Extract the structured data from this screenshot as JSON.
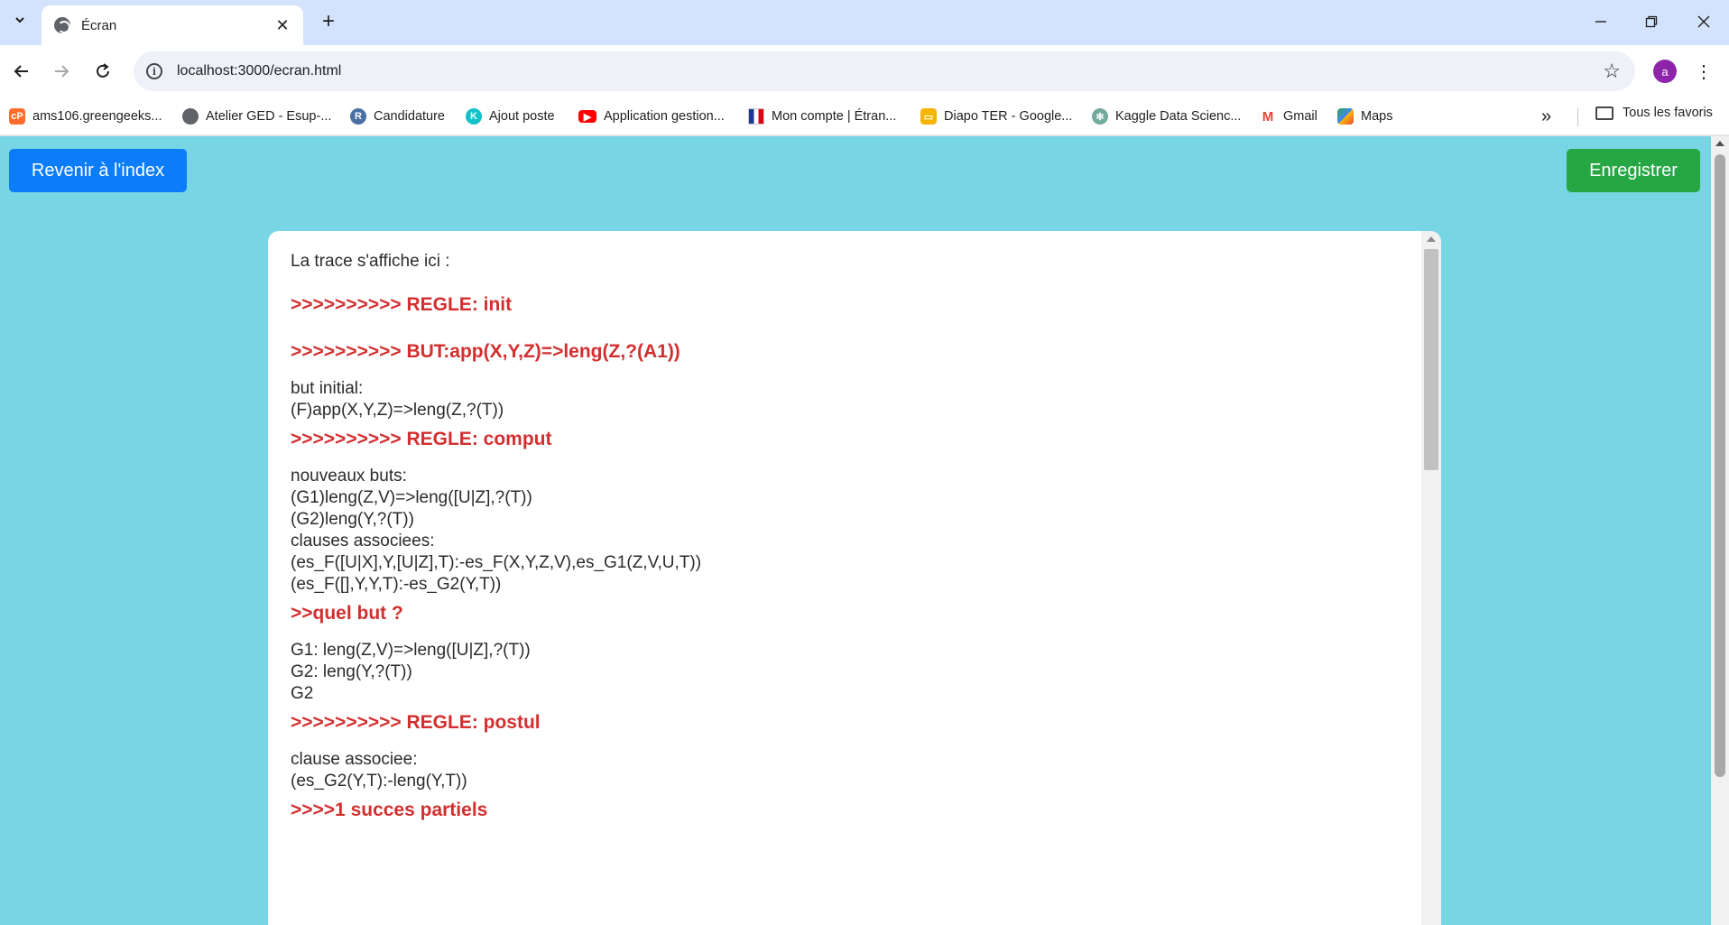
{
  "browser": {
    "tab_title": "Écran",
    "url": "localhost:3000/ecran.html",
    "avatar_letter": "a"
  },
  "bookmarks": {
    "items": [
      {
        "label": "ams106.greengeeks...",
        "icon": "cpanel-icon",
        "color": "#ff6c2c"
      },
      {
        "label": "Atelier GED - Esup-...",
        "icon": "globe-icon",
        "color": "#5f6368"
      },
      {
        "label": "Candidature",
        "icon": "r-icon",
        "color": "#4a6fa5"
      },
      {
        "label": "Ajout poste",
        "icon": "k-icon",
        "color": "#12c2c9"
      },
      {
        "label": "Application gestion...",
        "icon": "youtube-icon",
        "color": "#ff0000"
      },
      {
        "label": "Mon compte | Étran...",
        "icon": "france-flag-icon",
        "color": "#1a3a8f"
      },
      {
        "label": "Diapo TER - Google...",
        "icon": "slides-icon",
        "color": "#f4b400"
      },
      {
        "label": "Kaggle Data Scienc...",
        "icon": "openai-icon",
        "color": "#74aa9c"
      },
      {
        "label": "Gmail",
        "icon": "gmail-icon",
        "color": "#ea4335"
      },
      {
        "label": "Maps",
        "icon": "maps-icon",
        "color": "#34a853"
      }
    ],
    "more": "»",
    "folder_label": "Tous les favoris"
  },
  "page": {
    "back_button": "Revenir à l'index",
    "save_button": "Enregistrer",
    "colors": {
      "background": "#78d5e3",
      "back_button": "#0b7dfb",
      "save_button": "#26a744",
      "rule": "#d32f2f"
    },
    "trace": [
      {
        "kind": "text",
        "lines": [
          "La trace s'affiche ici :"
        ]
      },
      {
        "kind": "rule",
        "text": ">>>>>>>>>> REGLE: init"
      },
      {
        "kind": "rule",
        "text": ">>>>>>>>>> BUT:app(X,Y,Z)=>leng(Z,?(A1))"
      },
      {
        "kind": "text",
        "lines": [
          "but initial:",
          "(F)app(X,Y,Z)=>leng(Z,?(T))"
        ]
      },
      {
        "kind": "rule",
        "text": ">>>>>>>>>> REGLE: comput"
      },
      {
        "kind": "text",
        "lines": [
          "nouveaux buts:",
          "(G1)leng(Z,V)=>leng([U|Z],?(T))",
          "(G2)leng(Y,?(T))",
          "clauses associees:",
          "(es_F([U|X],Y,[U|Z],T):-es_F(X,Y,Z,V),es_G1(Z,V,U,T))",
          "(es_F([],Y,Y,T):-es_G2(Y,T))"
        ]
      },
      {
        "kind": "rule",
        "text": ">>quel but ?"
      },
      {
        "kind": "text",
        "lines": [
          "G1: leng(Z,V)=>leng([U|Z],?(T))",
          "G2: leng(Y,?(T))",
          "G2"
        ]
      },
      {
        "kind": "rule",
        "text": ">>>>>>>>>> REGLE: postul"
      },
      {
        "kind": "text",
        "lines": [
          "clause associee:",
          "(es_G2(Y,T):-leng(Y,T))"
        ]
      },
      {
        "kind": "rule",
        "text": ">>>>1 succes partiels"
      }
    ]
  }
}
